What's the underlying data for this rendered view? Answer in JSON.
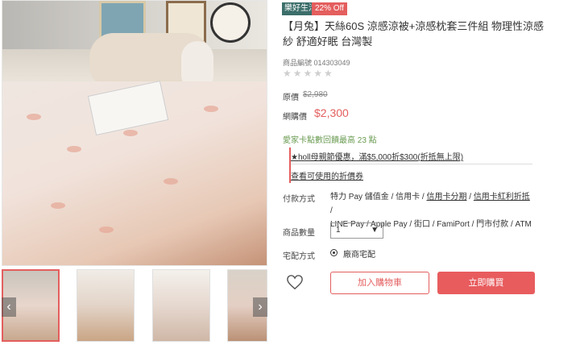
{
  "badges": {
    "brand": "樂好生活",
    "discount": "22% Off"
  },
  "product": {
    "title": "【月兔】天絲60S 涼感涼被+涼感枕套三件組 物理性涼感紗 舒適好眠 台灣製",
    "sku": "商品編號 014303049",
    "stars": "★★★★★"
  },
  "price": {
    "original_label": "原價",
    "original_value": "$2,980",
    "sale_label": "網購價",
    "sale_value": "$2,300"
  },
  "points_text": "愛家卡點數回饋最高 23 點",
  "promo": {
    "coupon_text": "★holl母親節優惠，滿$5,000折$300(折抵無上限)",
    "coupon_link": "查看可使用的折價券"
  },
  "payment": {
    "label": "付款方式",
    "line1_a": "特力 Pay 儲值金 / 信用卡 / ",
    "line1_b": "信用卡分期",
    "line1_c": " / ",
    "line1_d": "信用卡紅利折抵",
    "line1_e": " /",
    "line2": "LINE Pay / Apple Pay / 街口 / FamiPort / 門市付款 / ATM"
  },
  "quantity": {
    "label": "商品數量",
    "value": "1",
    "caret": "▼"
  },
  "delivery": {
    "label": "宅配方式",
    "option": "廠商宅配"
  },
  "actions": {
    "add_to_cart": "加入購物車",
    "buy_now": "立即購買"
  },
  "gallery": {
    "prev": "‹",
    "next": "›"
  },
  "colors": {
    "accent": "#e45e5e",
    "brand_badge": "#3b6e6a",
    "points": "#6a9b52"
  }
}
